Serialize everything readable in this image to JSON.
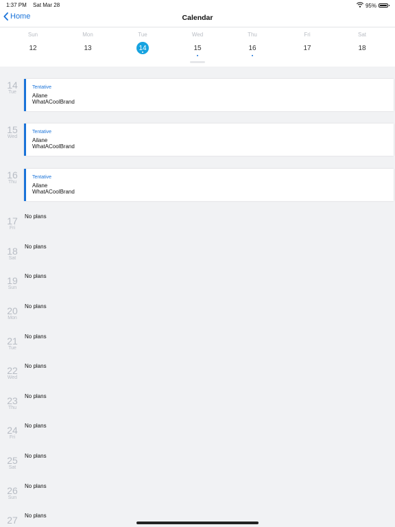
{
  "status_bar": {
    "time": "1:37 PM",
    "date": "Sat Mar 28",
    "battery": "95%",
    "battery_level": 0.95
  },
  "nav": {
    "back_label": "Home",
    "title": "Calendar"
  },
  "week": [
    {
      "name": "Sun",
      "num": "12",
      "selected": false,
      "has_event": false
    },
    {
      "name": "Mon",
      "num": "13",
      "selected": false,
      "has_event": false
    },
    {
      "name": "Tue",
      "num": "14",
      "selected": true,
      "has_event": true
    },
    {
      "name": "Wed",
      "num": "15",
      "selected": false,
      "has_event": true
    },
    {
      "name": "Thu",
      "num": "16",
      "selected": false,
      "has_event": true
    },
    {
      "name": "Fri",
      "num": "17",
      "selected": false,
      "has_event": false
    },
    {
      "name": "Sat",
      "num": "18",
      "selected": false,
      "has_event": false
    }
  ],
  "agenda": [
    {
      "num": "14",
      "wd": "Tue",
      "event": {
        "status": "Tentative",
        "name": "Ailane",
        "brand": "WhatACoolBrand"
      }
    },
    {
      "num": "15",
      "wd": "Wed",
      "event": {
        "status": "Tentative",
        "name": "Ailane",
        "brand": "WhatACoolBrand"
      }
    },
    {
      "num": "16",
      "wd": "Thu",
      "event": {
        "status": "Tentative",
        "name": "Ailane",
        "brand": "WhatACoolBrand"
      }
    },
    {
      "num": "17",
      "wd": "Fri",
      "empty": "No plans"
    },
    {
      "num": "18",
      "wd": "Sat",
      "empty": "No plans"
    },
    {
      "num": "19",
      "wd": "Sun",
      "empty": "No plans"
    },
    {
      "num": "20",
      "wd": "Mon",
      "empty": "No plans"
    },
    {
      "num": "21",
      "wd": "Tue",
      "empty": "No plans"
    },
    {
      "num": "22",
      "wd": "Wed",
      "empty": "No plans"
    },
    {
      "num": "23",
      "wd": "Thu",
      "empty": "No plans"
    },
    {
      "num": "24",
      "wd": "Fri",
      "empty": "No plans"
    },
    {
      "num": "25",
      "wd": "Sat",
      "empty": "No plans"
    },
    {
      "num": "26",
      "wd": "Sun",
      "empty": "No plans"
    },
    {
      "num": "27",
      "wd": "",
      "empty": "No plans"
    }
  ],
  "colors": {
    "accent": "#1a73d9",
    "selected_day": "#17a3e0",
    "background": "#f1f2f4",
    "muted": "#b7bcc4"
  },
  "icons": {
    "back": "chevron-left-icon",
    "wifi": "wifi-icon",
    "battery": "battery-icon"
  }
}
